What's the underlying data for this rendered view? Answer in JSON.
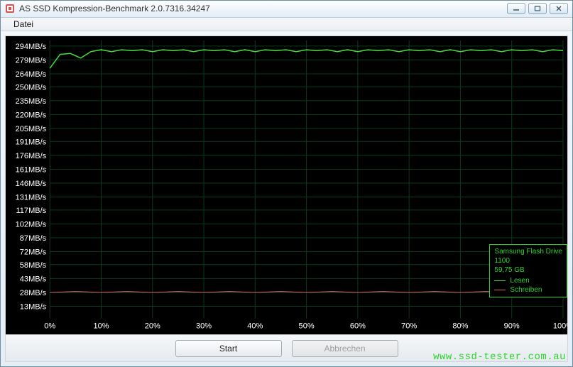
{
  "window": {
    "title": "AS SSD Kompression-Benchmark 2.0.7316.34247"
  },
  "menubar": {
    "datei": "Datei"
  },
  "buttons": {
    "start": "Start",
    "abort": "Abbrechen"
  },
  "legend": {
    "device": "Samsung Flash Drive",
    "revision": "1100",
    "capacity": "59,75 GB",
    "read_label": "Lesen",
    "write_label": "Schreiben"
  },
  "watermark": "www.ssd-tester.com.au",
  "chart_data": {
    "type": "line",
    "xlabel": "",
    "ylabel": "",
    "x_unit": "%",
    "y_unit": "MB/s",
    "y_ticks": [
      13,
      28,
      43,
      58,
      72,
      87,
      102,
      117,
      131,
      146,
      161,
      176,
      191,
      205,
      220,
      235,
      250,
      264,
      279,
      294
    ],
    "x_ticks": [
      0,
      10,
      20,
      30,
      40,
      50,
      60,
      70,
      80,
      90,
      100
    ],
    "xlim": [
      0,
      100
    ],
    "ylim": [
      0,
      300
    ],
    "series": [
      {
        "name": "Lesen",
        "color": "#3fe038",
        "values": [
          {
            "x": 0,
            "y": 270
          },
          {
            "x": 2,
            "y": 285
          },
          {
            "x": 4,
            "y": 286
          },
          {
            "x": 6,
            "y": 281
          },
          {
            "x": 8,
            "y": 288
          },
          {
            "x": 10,
            "y": 290
          },
          {
            "x": 12,
            "y": 288
          },
          {
            "x": 14,
            "y": 290
          },
          {
            "x": 16,
            "y": 289
          },
          {
            "x": 18,
            "y": 290
          },
          {
            "x": 20,
            "y": 288
          },
          {
            "x": 22,
            "y": 290
          },
          {
            "x": 24,
            "y": 289
          },
          {
            "x": 26,
            "y": 290
          },
          {
            "x": 28,
            "y": 288
          },
          {
            "x": 30,
            "y": 290
          },
          {
            "x": 32,
            "y": 289
          },
          {
            "x": 34,
            "y": 290
          },
          {
            "x": 36,
            "y": 288
          },
          {
            "x": 38,
            "y": 290
          },
          {
            "x": 40,
            "y": 288
          },
          {
            "x": 42,
            "y": 290
          },
          {
            "x": 44,
            "y": 289
          },
          {
            "x": 46,
            "y": 290
          },
          {
            "x": 48,
            "y": 288
          },
          {
            "x": 50,
            "y": 290
          },
          {
            "x": 52,
            "y": 289
          },
          {
            "x": 54,
            "y": 290
          },
          {
            "x": 56,
            "y": 288
          },
          {
            "x": 58,
            "y": 290
          },
          {
            "x": 60,
            "y": 288
          },
          {
            "x": 62,
            "y": 290
          },
          {
            "x": 64,
            "y": 289
          },
          {
            "x": 66,
            "y": 290
          },
          {
            "x": 68,
            "y": 288
          },
          {
            "x": 70,
            "y": 290
          },
          {
            "x": 72,
            "y": 289
          },
          {
            "x": 74,
            "y": 290
          },
          {
            "x": 76,
            "y": 288
          },
          {
            "x": 78,
            "y": 290
          },
          {
            "x": 80,
            "y": 288
          },
          {
            "x": 82,
            "y": 290
          },
          {
            "x": 84,
            "y": 289
          },
          {
            "x": 86,
            "y": 290
          },
          {
            "x": 88,
            "y": 288
          },
          {
            "x": 90,
            "y": 290
          },
          {
            "x": 92,
            "y": 289
          },
          {
            "x": 94,
            "y": 290
          },
          {
            "x": 96,
            "y": 288
          },
          {
            "x": 98,
            "y": 290
          },
          {
            "x": 100,
            "y": 289
          }
        ]
      },
      {
        "name": "Schreiben",
        "color": "#d86a6a",
        "values": [
          {
            "x": 0,
            "y": 28
          },
          {
            "x": 5,
            "y": 29
          },
          {
            "x": 10,
            "y": 28
          },
          {
            "x": 15,
            "y": 29
          },
          {
            "x": 20,
            "y": 28
          },
          {
            "x": 25,
            "y": 29
          },
          {
            "x": 30,
            "y": 28
          },
          {
            "x": 35,
            "y": 29
          },
          {
            "x": 40,
            "y": 28
          },
          {
            "x": 45,
            "y": 29
          },
          {
            "x": 50,
            "y": 28
          },
          {
            "x": 55,
            "y": 29
          },
          {
            "x": 60,
            "y": 28
          },
          {
            "x": 65,
            "y": 29
          },
          {
            "x": 70,
            "y": 28
          },
          {
            "x": 75,
            "y": 29
          },
          {
            "x": 80,
            "y": 28
          },
          {
            "x": 85,
            "y": 29
          },
          {
            "x": 90,
            "y": 28
          },
          {
            "x": 95,
            "y": 29
          },
          {
            "x": 100,
            "y": 28
          }
        ]
      }
    ]
  }
}
